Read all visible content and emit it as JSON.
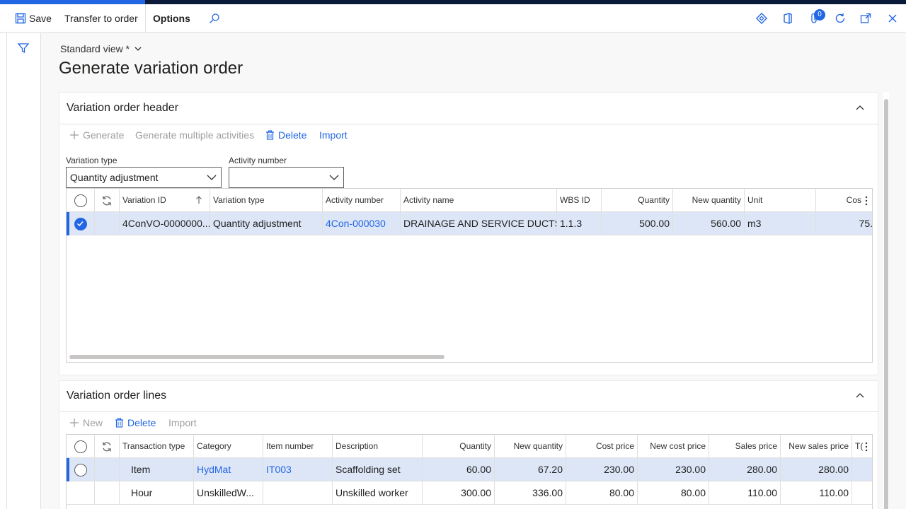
{
  "actionpane": {
    "save_label": "Save",
    "transfer_label": "Transfer to order",
    "options_label": "Options",
    "notification_count": "0"
  },
  "view": {
    "label": "Standard view *"
  },
  "page": {
    "title": "Generate variation order"
  },
  "header_section": {
    "title": "Variation order header",
    "toolbar": {
      "generate": "Generate",
      "generate_multiple": "Generate multiple activities",
      "delete": "Delete",
      "import": "Import"
    },
    "fields": {
      "variation_type_label": "Variation type",
      "variation_type_value": "Quantity adjustment",
      "activity_number_label": "Activity number",
      "activity_number_value": ""
    },
    "columns": [
      "Variation ID",
      "Variation type",
      "Activity number",
      "Activity name",
      "WBS ID",
      "Quantity",
      "New quantity",
      "Unit",
      "Cos"
    ],
    "rows": [
      {
        "variation_id": "4ConVO-0000000...",
        "variation_type": "Quantity adjustment",
        "activity_number": "4Con-000030",
        "activity_name": "DRAINAGE AND SERVICE DUCTS",
        "wbs_id": "1.1.3",
        "quantity": "500.00",
        "new_quantity": "560.00",
        "unit": "m3",
        "cost": "75."
      }
    ]
  },
  "lines_section": {
    "title": "Variation order lines",
    "toolbar": {
      "new": "New",
      "delete": "Delete",
      "import": "Import"
    },
    "columns": [
      "Transaction type",
      "Category",
      "Item number",
      "Description",
      "Quantity",
      "New quantity",
      "Cost price",
      "New cost price",
      "Sales price",
      "New sales price",
      "T("
    ],
    "rows": [
      {
        "transaction_type": "Item",
        "category": "HydMat",
        "item_number": "IT003",
        "description": "Scaffolding set",
        "quantity": "60.00",
        "new_quantity": "67.20",
        "cost_price": "230.00",
        "new_cost_price": "230.00",
        "sales_price": "280.00",
        "new_sales_price": "280.00"
      },
      {
        "transaction_type": "Hour",
        "category": "UnskilledW...",
        "item_number": "",
        "description": "Unskilled worker",
        "quantity": "300.00",
        "new_quantity": "336.00",
        "cost_price": "80.00",
        "new_cost_price": "80.00",
        "sales_price": "110.00",
        "new_sales_price": "110.00"
      }
    ]
  },
  "colors": {
    "accent": "#2266e3",
    "topbar": "#0b1a38",
    "selected_row": "#dce6f7"
  }
}
